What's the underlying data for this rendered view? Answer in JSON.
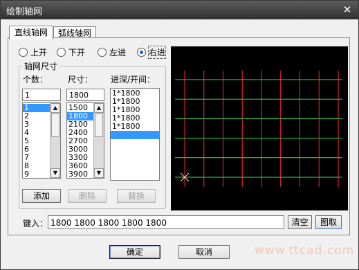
{
  "window": {
    "title": "绘制轴网",
    "close_glyph": "✕"
  },
  "tabs": [
    {
      "label": "直线轴网",
      "active": true
    },
    {
      "label": "弧线轴网",
      "active": false
    }
  ],
  "radios": [
    {
      "label": "上开",
      "checked": false
    },
    {
      "label": "下开",
      "checked": false
    },
    {
      "label": "左进",
      "checked": false
    },
    {
      "label": "右进",
      "checked": true
    }
  ],
  "group": {
    "title": "轴网尺寸",
    "count_label": "个数：",
    "size_label": "尺寸：",
    "depth_label": "进深/开间：",
    "count_value": "1",
    "size_value": "1800",
    "count_items": [
      "1",
      "2",
      "3",
      "4",
      "5",
      "6",
      "7",
      "8",
      "9"
    ],
    "count_selected": 0,
    "size_items": [
      "1500",
      "1800",
      "2100",
      "2400",
      "2700",
      "3000",
      "3300",
      "3600",
      "3900"
    ],
    "size_selected": 1,
    "depth_items": [
      "1*1800",
      "1*1800",
      "1*1800",
      "1*1800",
      "1*1800"
    ],
    "add_label": "添加",
    "delete_label": "删除",
    "replace_label": "替换"
  },
  "input_row": {
    "label": "键入：",
    "value": "1800  1800  1800  1800  1800",
    "clear_label": "清空",
    "pick_label": "图取"
  },
  "footer": {
    "ok_label": "确定",
    "cancel_label": "取消"
  },
  "watermark": "www.ttcad.com",
  "preview": {
    "background": "#000000",
    "vertical_color": "#ff2a2a",
    "horizontal_color": "#33dd55",
    "marker_color": "#e8e8c0",
    "vertical_count": 9,
    "horizontal_count": 6
  }
}
